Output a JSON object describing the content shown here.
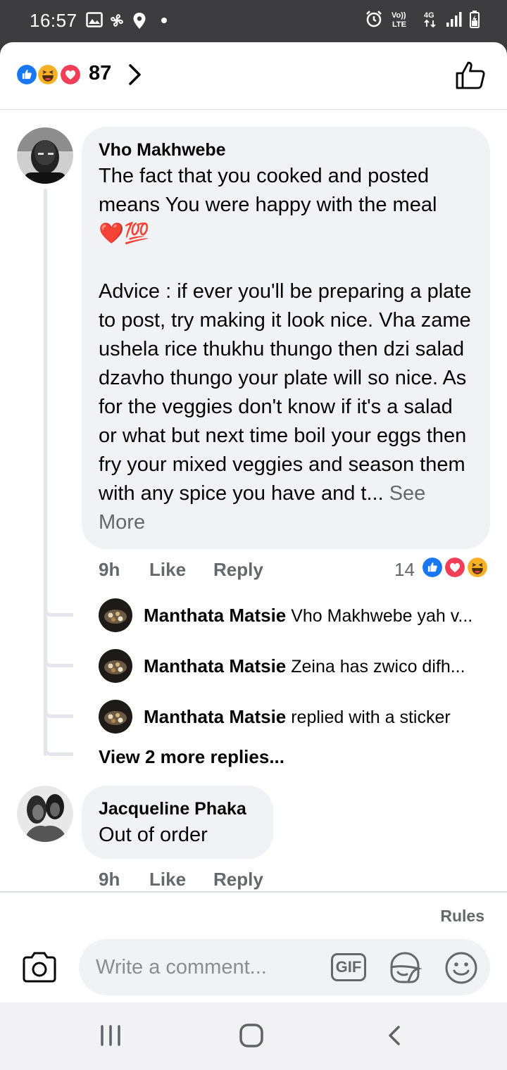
{
  "status_bar": {
    "time": "16:57",
    "network": "4G",
    "volte": "Vo)) LTE",
    "left_icons": [
      "gallery-icon",
      "pinwheel-icon",
      "location-icon",
      "dot-icon"
    ],
    "right_icons": [
      "alarm-icon",
      "volte-icon",
      "4g-icon",
      "signal-icon",
      "battery-icon"
    ]
  },
  "reactions_header": {
    "count": "87",
    "reaction_types": [
      "like",
      "haha",
      "love"
    ],
    "colors": {
      "like": "#1877f2",
      "love": "#f33e58",
      "haha": "#f7b125"
    }
  },
  "comments": [
    {
      "author": "Vho Makhwebe",
      "text": "The fact that you cooked and posted means You were happy with the meal\n❤️💯\n\nAdvice : if ever you'll be preparing a plate to post, try making it look nice. Vha zame ushela rice thukhu thungo then dzi salad dzavho thungo your plate will so nice. As for the veggies don't know if it's a salad or what but next time boil your eggs then fry your mixed veggies and season them with any spice you have and t... ",
      "see_more": "See More",
      "time": "9h",
      "like_label": "Like",
      "reply_label": "Reply",
      "reaction_count": "14",
      "replies": [
        {
          "author": "Manthata Matsie",
          "text": "Vho Makhwebe yah v..."
        },
        {
          "author": "Manthata Matsie",
          "text": "Zeina has zwico difh..."
        },
        {
          "author": "Manthata Matsie",
          "text": "replied with a sticker"
        }
      ],
      "view_more_replies": "View 2 more replies..."
    },
    {
      "author": "Jacqueline Phaka",
      "text": "Out of order",
      "time": "9h",
      "like_label": "Like",
      "reply_label": "Reply"
    }
  ],
  "composer": {
    "rules_label": "Rules",
    "placeholder": "Write a comment...",
    "gif_label": "GIF"
  },
  "nav_bar": {
    "items": [
      "recent-apps",
      "home",
      "back"
    ]
  }
}
